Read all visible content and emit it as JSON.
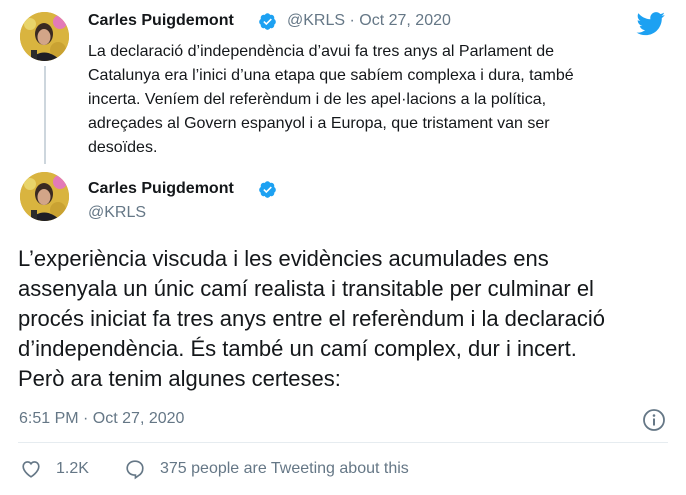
{
  "parent_tweet": {
    "author_name": "Carles Puigdemont",
    "handle": "@KRLS",
    "separator": "·",
    "date": "Oct 27, 2020",
    "text_lines": [
      "La declaració d’independència d’avui fa tres anys al Parlament de",
      "Catalunya era l’inici d’una etapa que sabíem complexa i dura, també",
      "incerta. Veníem del referèndum i de les apel·lacions a la política,",
      "adreçades al Govern espanyol i a Europa, que tristament van ser",
      "desoïdes."
    ]
  },
  "main_tweet": {
    "author_name": "Carles Puigdemont",
    "handle": "@KRLS",
    "text_lines": [
      "L’experiència viscuda i les evidències acumulades ens",
      "assenyala un únic camí realista i transitable per culminar el",
      "procés iniciat fa tres anys entre el referèndum i la declaració",
      "d’independència. És també un camí complex, dur i incert.",
      "Però ara tenim algunes certeses:"
    ],
    "timestamp": "6:51 PM · Oct 27, 2020",
    "likes": "1.2K",
    "conversation": "375 people are Tweeting about this"
  },
  "icons": {
    "brand": "twitter-bird-icon",
    "verified": "verified-badge-icon",
    "info": "info-icon",
    "like": "heart-icon",
    "reply": "speech-bubble-icon"
  },
  "colors": {
    "brand": "#1da1f2",
    "text": "#14171a",
    "muted": "#657786",
    "thread_line": "#cdd6dd"
  }
}
